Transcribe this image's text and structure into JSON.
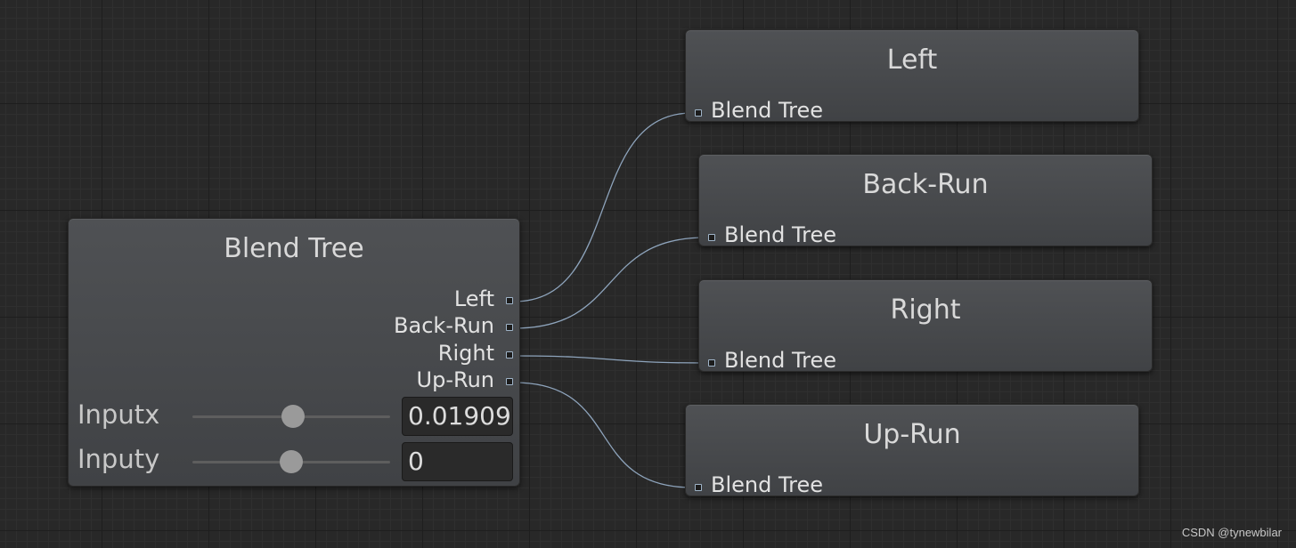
{
  "blend_tree_node": {
    "title": "Blend Tree",
    "outputs": [
      "Left",
      "Back-Run",
      "Right",
      "Up-Run"
    ],
    "params": [
      {
        "label": "Inputx",
        "value": "0.01909",
        "slider_fraction": 0.51
      },
      {
        "label": "Inputy",
        "value": "0",
        "slider_fraction": 0.5
      }
    ]
  },
  "motion_nodes": [
    {
      "title": "Left",
      "input_label": "Blend Tree"
    },
    {
      "title": "Back-Run",
      "input_label": "Blend Tree"
    },
    {
      "title": "Right",
      "input_label": "Blend Tree"
    },
    {
      "title": "Up-Run",
      "input_label": "Blend Tree"
    }
  ],
  "colors": {
    "wire": "#8ea4bc",
    "node": "#46484b",
    "background": "#282828"
  },
  "watermark": "CSDN @tynewbilar"
}
